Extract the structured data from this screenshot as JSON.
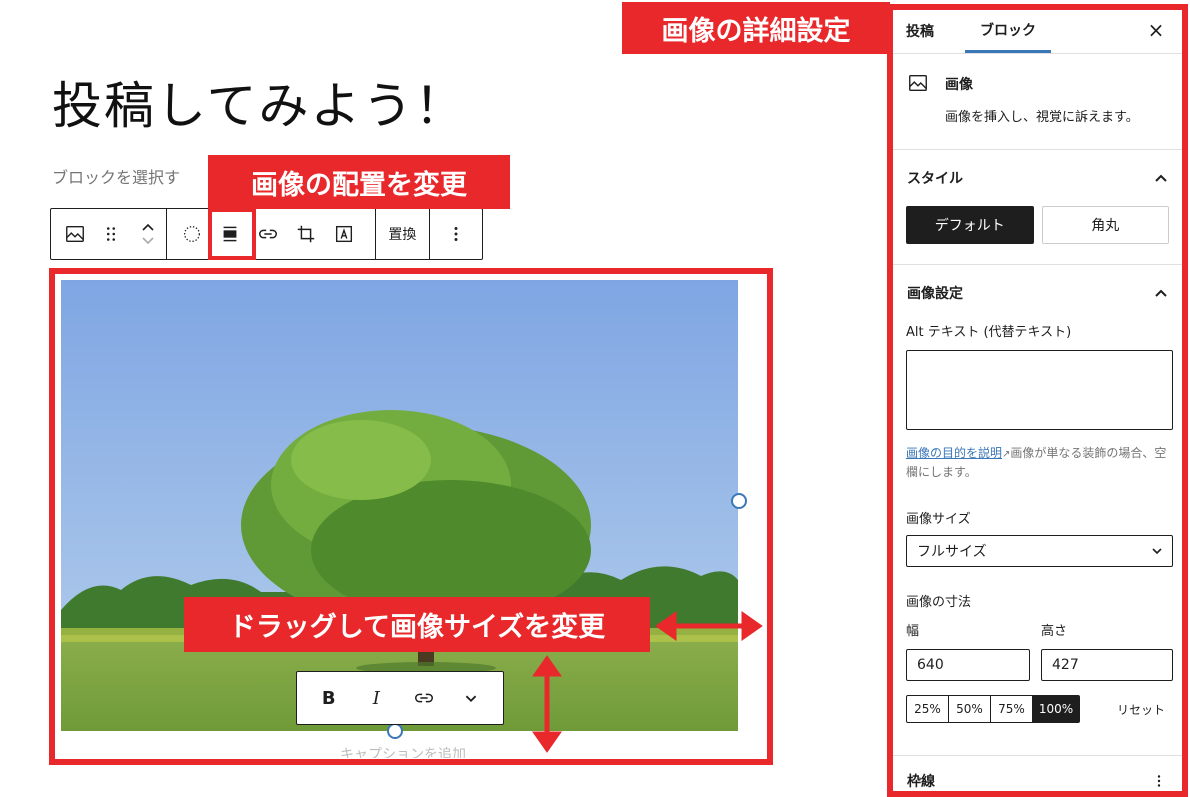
{
  "editor": {
    "post_title": "投稿してみよう！",
    "hint": "ブロックを選択す",
    "caption_placeholder": "キャプションを追加"
  },
  "toolbar": {
    "replace_label": "置換"
  },
  "inline_toolbar": {
    "bold_label": "B",
    "italic_label": "I"
  },
  "annotations": {
    "align_label": "画像の配置を変更",
    "drag_label": "ドラッグして画像サイズを変更",
    "detail_label": "画像の詳細設定"
  },
  "sidebar": {
    "tabs": [
      {
        "label": "投稿"
      },
      {
        "label": "ブロック"
      }
    ],
    "close_label": "×",
    "block": {
      "title": "画像",
      "description": "画像を挿入し、視覚に訴えます。"
    },
    "styles": {
      "heading": "スタイル",
      "options": [
        {
          "label": "デフォルト"
        },
        {
          "label": "角丸"
        }
      ]
    },
    "image_settings": {
      "heading": "画像設定",
      "alt_label": "Alt テキスト (代替テキスト)",
      "help_link": "画像の目的を説明",
      "help_text": "画像が単なる装飾の場合、空欄にします。",
      "size_label": "画像サイズ",
      "size_value": "フルサイズ",
      "dims_label": "画像の寸法",
      "width_label": "幅",
      "width_value": "640",
      "height_label": "高さ",
      "height_value": "427",
      "percent_options": [
        "25%",
        "50%",
        "75%",
        "100%"
      ],
      "reset_label": "リセット"
    },
    "border_heading": "枠線"
  },
  "colors": {
    "annotation_red": "#e8282b",
    "accent_blue": "#3a77b8",
    "dark": "#1e1e1e"
  }
}
